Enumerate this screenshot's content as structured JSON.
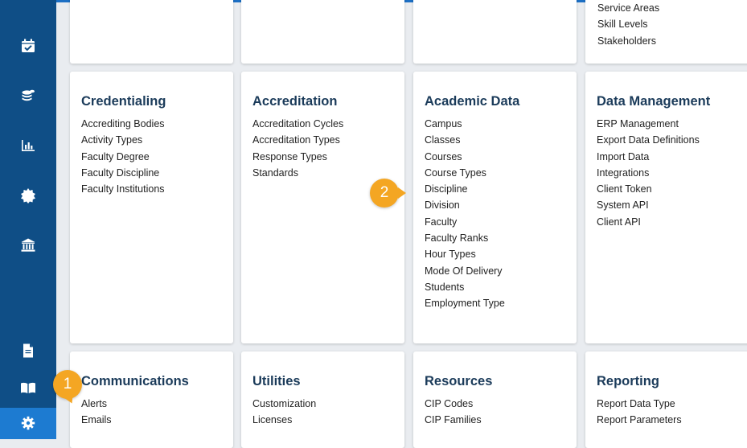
{
  "sidebar": {
    "icons": [
      {
        "name": "calendar-check-icon"
      },
      {
        "name": "coins-stack-icon"
      },
      {
        "name": "bar-chart-icon"
      },
      {
        "name": "badge-seal-icon"
      },
      {
        "name": "institution-icon"
      },
      {
        "name": "document-icon"
      },
      {
        "name": "book-open-icon"
      },
      {
        "name": "gear-icon"
      }
    ]
  },
  "top_partial": {
    "items": [
      "Service Areas",
      "Skill Levels",
      "Stakeholders"
    ]
  },
  "cards": {
    "credentialing": {
      "title": "Credentialing",
      "items": [
        "Accrediting Bodies",
        "Activity Types",
        "Faculty Degree",
        "Faculty Discipline",
        "Faculty Institutions"
      ]
    },
    "accreditation": {
      "title": "Accreditation",
      "items": [
        "Accreditation Cycles",
        "Accreditation Types",
        "Response Types",
        "Standards"
      ]
    },
    "academic_data": {
      "title": "Academic Data",
      "items": [
        "Campus",
        "Classes",
        "Courses",
        "Course Types",
        "Discipline",
        "Division",
        "Faculty",
        "Faculty Ranks",
        "Hour Types",
        "Mode Of Delivery",
        "Students",
        "Employment Type"
      ]
    },
    "data_management": {
      "title": "Data Management",
      "items": [
        "ERP Management",
        "Export Data Definitions",
        "Import Data",
        "Integrations",
        "Client Token",
        "System API",
        "Client API"
      ]
    },
    "communications": {
      "title": "Communications",
      "items": [
        "Alerts",
        "Emails"
      ]
    },
    "utilities": {
      "title": "Utilities",
      "items": [
        "Customization",
        "Licenses"
      ]
    },
    "resources": {
      "title": "Resources",
      "items": [
        "CIP Codes",
        "CIP Families"
      ]
    },
    "reporting": {
      "title": "Reporting",
      "items": [
        "Report Data Type",
        "Report Parameters"
      ]
    }
  },
  "callouts": {
    "one": "1",
    "two": "2"
  },
  "colors": {
    "sidebar": "#0f4e86",
    "sidebar_active": "#1d7bd1",
    "callout": "#f4a623",
    "title": "#1b3b5a"
  }
}
